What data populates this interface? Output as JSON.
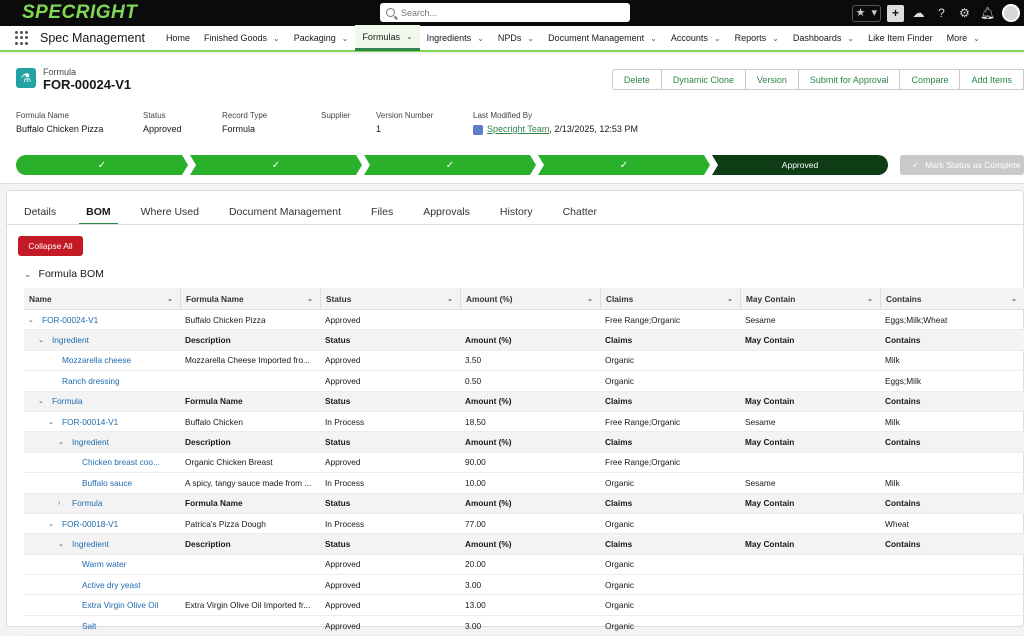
{
  "header": {
    "logo": "SPECRIGHT",
    "search_placeholder": "Search..."
  },
  "nav": {
    "app_name": "Spec Management",
    "items": [
      {
        "label": "Home",
        "dropdown": false
      },
      {
        "label": "Finished Goods",
        "dropdown": true
      },
      {
        "label": "Packaging",
        "dropdown": true
      },
      {
        "label": "Formulas",
        "dropdown": true,
        "active": true
      },
      {
        "label": "Ingredients",
        "dropdown": true
      },
      {
        "label": "NPDs",
        "dropdown": true
      },
      {
        "label": "Document Management",
        "dropdown": true
      },
      {
        "label": "Accounts",
        "dropdown": true
      },
      {
        "label": "Reports",
        "dropdown": true
      },
      {
        "label": "Dashboards",
        "dropdown": true
      },
      {
        "label": "Like Item Finder",
        "dropdown": false
      },
      {
        "label": "More",
        "dropdown": true
      }
    ]
  },
  "record": {
    "object_type": "Formula",
    "title": "FOR-00024-V1",
    "actions": [
      "Delete",
      "Dynamic Clone",
      "Version",
      "Submit for Approval",
      "Compare",
      "Add Items"
    ],
    "fields": [
      {
        "label": "Formula Name",
        "value": "Buffalo Chicken Pizza"
      },
      {
        "label": "Status",
        "value": "Approved"
      },
      {
        "label": "Record Type",
        "value": "Formula"
      },
      {
        "label": "Supplier",
        "value": ""
      },
      {
        "label": "Version Number",
        "value": "1"
      },
      {
        "label": "Last Modified By",
        "value": "Specright Team",
        "suffix": ", 2/13/2025, 12:53 PM"
      }
    ],
    "path_final": "Approved",
    "mark_button": "Mark Status as Complete"
  },
  "tabs": [
    "Details",
    "BOM",
    "Where Used",
    "Document Management",
    "Files",
    "Approvals",
    "History",
    "Chatter"
  ],
  "active_tab": "BOM",
  "collapse_label": "Collapse All",
  "bom_title": "Formula BOM",
  "grid": {
    "headers": [
      "Name",
      "Formula Name",
      "Status",
      "Amount (%)",
      "Claims",
      "May Contain",
      "Contains"
    ],
    "rows": [
      {
        "level": 1,
        "toggle": "open",
        "sub": false,
        "cells": [
          "FOR-00024-V1",
          "Buffalo Chicken Pizza",
          "Approved",
          "",
          "Free Range;Organic",
          "Sesame",
          "Eggs;Milk;Wheat"
        ]
      },
      {
        "level": 2,
        "toggle": "open",
        "sub": true,
        "cells": [
          "Ingredient",
          "Description",
          "Status",
          "Amount (%)",
          "Claims",
          "May Contain",
          "Contains"
        ]
      },
      {
        "level": 3,
        "toggle": "none",
        "sub": false,
        "cells": [
          "Mozzarella cheese",
          "Mozzarella Cheese Imported fro...",
          "Approved",
          "3.50",
          "Organic",
          "",
          "Milk"
        ]
      },
      {
        "level": 3,
        "toggle": "none",
        "sub": false,
        "cells": [
          "Ranch dressing",
          "",
          "Approved",
          "0.50",
          "Organic",
          "",
          "Eggs;Milk"
        ]
      },
      {
        "level": 2,
        "toggle": "open",
        "sub": true,
        "cells": [
          "Formula",
          "Formula Name",
          "Status",
          "Amount (%)",
          "Claims",
          "May Contain",
          "Contains"
        ]
      },
      {
        "level": 3,
        "toggle": "open",
        "sub": false,
        "cells": [
          "FOR-00014-V1",
          "Buffalo Chicken",
          "In Process",
          "18.50",
          "Free Range;Organic",
          "Sesame",
          "Milk"
        ]
      },
      {
        "level": 4,
        "toggle": "open",
        "sub": true,
        "cells": [
          "Ingredient",
          "Description",
          "Status",
          "Amount (%)",
          "Claims",
          "May Contain",
          "Contains"
        ]
      },
      {
        "level": 5,
        "toggle": "none",
        "sub": false,
        "cells": [
          "Chicken breast coo...",
          "Organic Chicken Breast",
          "Approved",
          "90.00",
          "Free Range;Organic",
          "",
          ""
        ]
      },
      {
        "level": 5,
        "toggle": "none",
        "sub": false,
        "cells": [
          "Buffalo sauce",
          "A spicy, tangy sauce made from ...",
          "In Process",
          "10.00",
          "Organic",
          "Sesame",
          "Milk"
        ]
      },
      {
        "level": 4,
        "toggle": "closed",
        "sub": true,
        "cells": [
          "Formula",
          "Formula Name",
          "Status",
          "Amount (%)",
          "Claims",
          "May Contain",
          "Contains"
        ]
      },
      {
        "level": 3,
        "toggle": "open",
        "sub": false,
        "cells": [
          "FOR-00018-V1",
          "Patrica's Pizza Dough",
          "In Process",
          "77.00",
          "Organic",
          "",
          "Wheat"
        ]
      },
      {
        "level": 4,
        "toggle": "open",
        "sub": true,
        "cells": [
          "Ingredient",
          "Description",
          "Status",
          "Amount (%)",
          "Claims",
          "May Contain",
          "Contains"
        ]
      },
      {
        "level": 5,
        "toggle": "none",
        "sub": false,
        "cells": [
          "Warm water",
          "",
          "Approved",
          "20.00",
          "Organic",
          "",
          ""
        ]
      },
      {
        "level": 5,
        "toggle": "none",
        "sub": false,
        "cells": [
          "Active dry yeast",
          "",
          "Approved",
          "3.00",
          "Organic",
          "",
          ""
        ]
      },
      {
        "level": 5,
        "toggle": "none",
        "sub": false,
        "cells": [
          "Extra Virgin Olive Oil",
          "Extra Virgin Olive Oil Imported fr...",
          "Approved",
          "13.00",
          "Organic",
          "",
          ""
        ]
      },
      {
        "level": 5,
        "toggle": "none",
        "sub": false,
        "cells": [
          "Salt",
          "",
          "Approved",
          "3.00",
          "Organic",
          "",
          ""
        ]
      }
    ]
  },
  "colors": {
    "brand_green": "#7ed957",
    "path_green": "#2bb02b",
    "path_final": "#0e3d15",
    "link_blue": "#1f6bb0",
    "action_green": "#2e844a",
    "danger_red": "#c41a26"
  }
}
